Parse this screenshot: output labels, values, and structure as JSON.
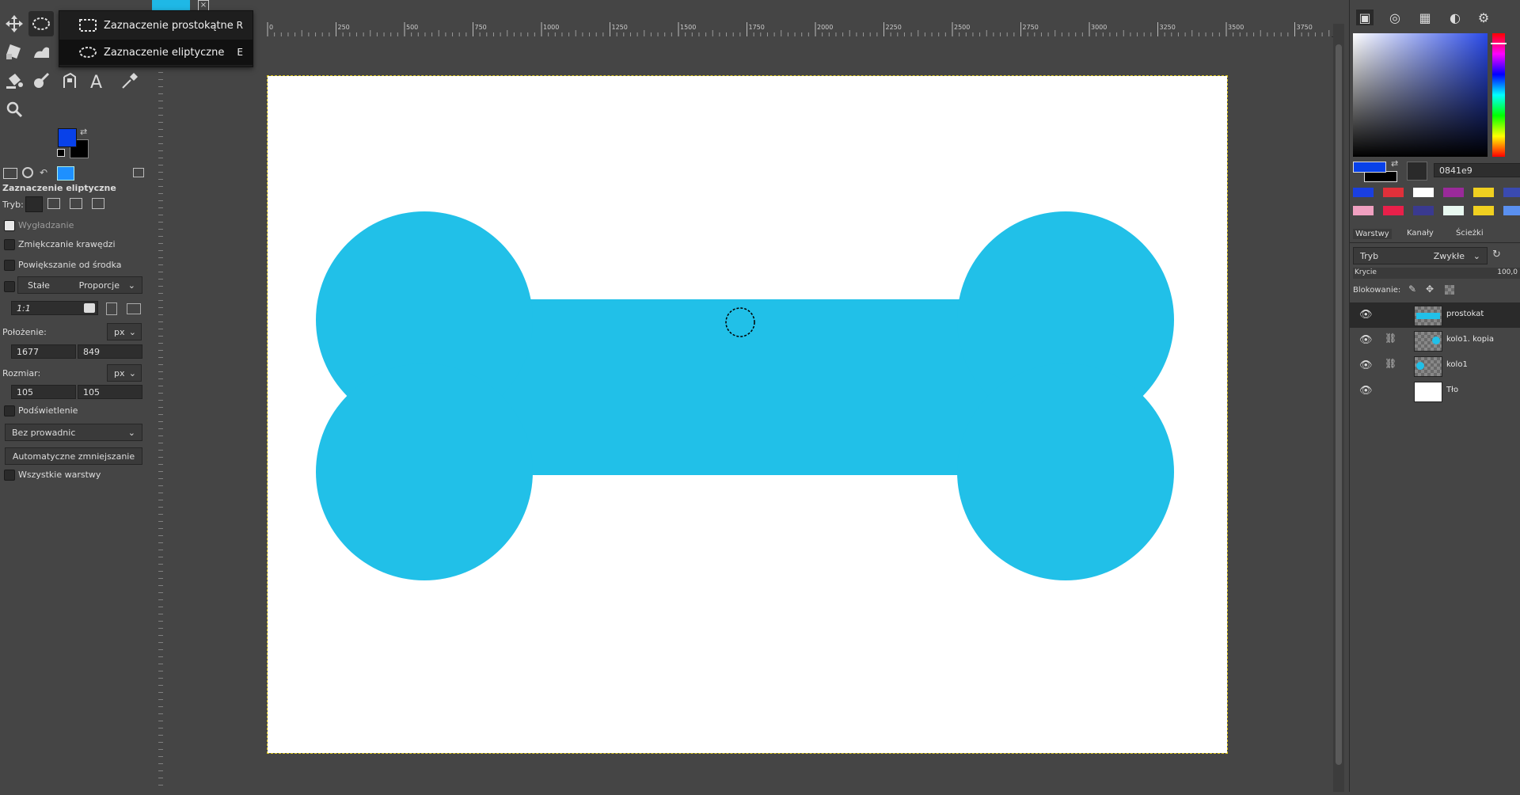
{
  "popup": {
    "items": [
      {
        "label": "Zaznaczenie prostokątne",
        "key": "R"
      },
      {
        "label": "Zaznaczenie eliptyczne",
        "key": "E"
      }
    ]
  },
  "tool_options": {
    "title": "Zaznaczenie eliptyczne",
    "mode_label": "Tryb:",
    "antialias_label": "Wygładzanie",
    "feather_label": "Zmiękczanie krawędzi",
    "expand_label": "Powiększanie od środka",
    "fixed_label": "Stałe",
    "fixed_value": "Proporcje",
    "ratio_value": "1:1",
    "position_label": "Położenie:",
    "position_unit": "px",
    "position_x": "1677",
    "position_y": "849",
    "size_label": "Rozmiar:",
    "size_unit": "px",
    "size_w": "105",
    "size_h": "105",
    "highlight_label": "Podświetlenie",
    "guides_value": "Bez prowadnic",
    "autoshrink_label": "Automatyczne zmniejszanie",
    "all_layers_label": "Wszystkie warstwy"
  },
  "ruler": {
    "labels": [
      "0",
      "250",
      "500",
      "750",
      "1000",
      "1250",
      "1500",
      "1750",
      "2000",
      "2250",
      "2500",
      "2750",
      "3000",
      "3250",
      "3500",
      "3750"
    ]
  },
  "colors": {
    "foreground": "#0841e9",
    "background": "#000000",
    "bone": "#21c0e8",
    "hex_value": "0841e9"
  },
  "palette": {
    "row1": [
      "#1a3fe0",
      "#e0303a",
      "#ffffff",
      "#9a2a9a",
      "#f0d020",
      "#3a4ab0"
    ],
    "row2": [
      "#f0a0c0",
      "#e8204a",
      "#3a3a90",
      "#e8f8f0",
      "#f0d020",
      "#5a90f0"
    ]
  },
  "layers_panel": {
    "tabs": [
      "Warstwy",
      "Kanały",
      "Ścieżki"
    ],
    "mode_label": "Tryb",
    "mode_value": "Zwykłe",
    "opacity_label": "Krycie",
    "opacity_value": "100,0",
    "lock_label": "Blokowanie:",
    "layers": [
      {
        "name": "prostokat",
        "linked": false,
        "thumb": "rect"
      },
      {
        "name": "kolo1. kopia",
        "linked": true,
        "thumb": "circle-right"
      },
      {
        "name": "kolo1",
        "linked": true,
        "thumb": "circle-left"
      },
      {
        "name": "Tło",
        "linked": false,
        "thumb": "white"
      }
    ]
  }
}
